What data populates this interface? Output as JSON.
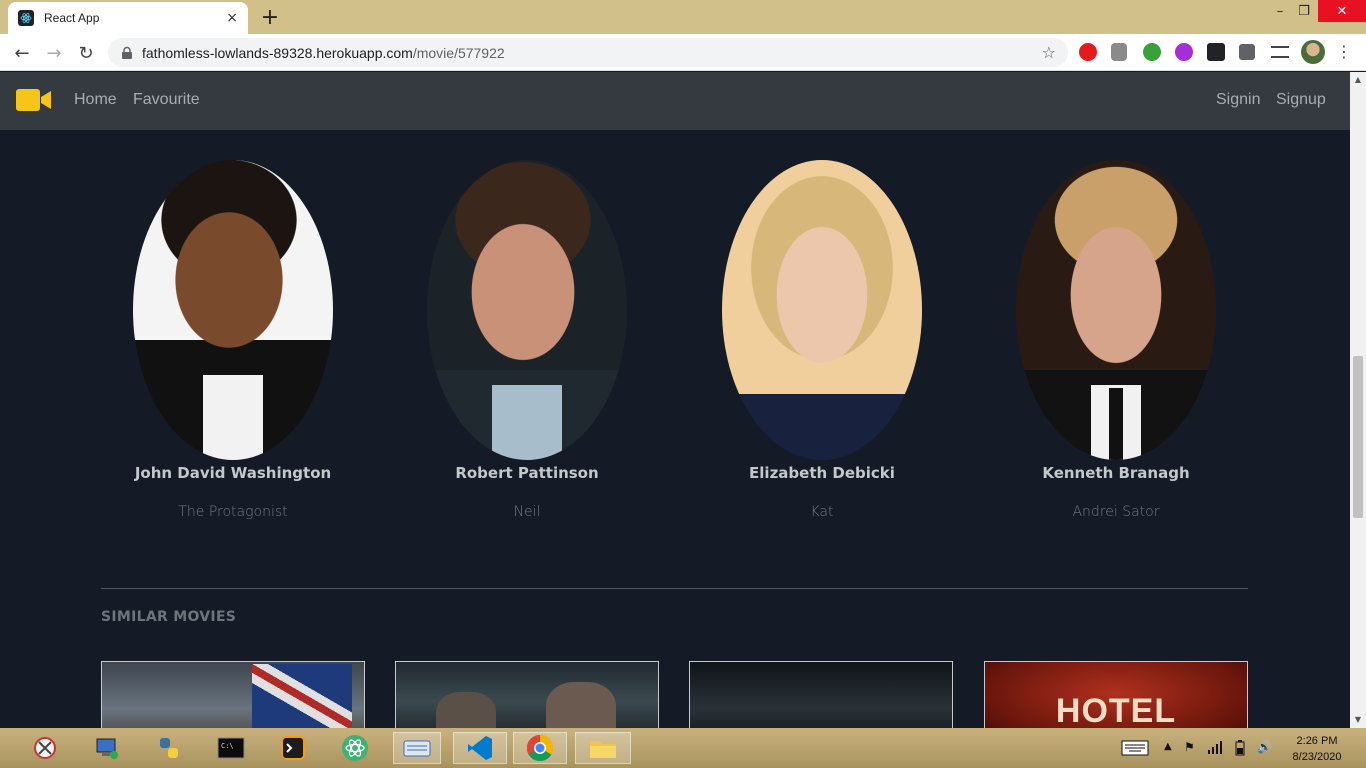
{
  "browser": {
    "tab_title": "React App",
    "url_host": "fathomless-lowlands-89328.herokuapp.com",
    "url_path": "/movie/577922",
    "tab_close": "×",
    "new_tab": "+",
    "window": {
      "minimize": "–",
      "maximize": "❐",
      "close": "✕"
    },
    "back": "←",
    "forward": "→",
    "reload": "↻",
    "star": "☆",
    "menu": "⋮"
  },
  "app_nav": {
    "links": [
      "Home",
      "Favourite"
    ],
    "auth": [
      "Signin",
      "Signup"
    ]
  },
  "cast": [
    {
      "name": "John David Washington",
      "role": "The Protagonist"
    },
    {
      "name": "Robert Pattinson",
      "role": "Neil"
    },
    {
      "name": "Elizabeth Debicki",
      "role": "Kat"
    },
    {
      "name": "Kenneth Branagh",
      "role": "Andrei Sator"
    }
  ],
  "similar": {
    "title": "SIMILAR MOVIES",
    "posters": [
      {
        "text": ""
      },
      {
        "text": ""
      },
      {
        "text": ""
      },
      {
        "text": "HOTEL MUMBAI"
      }
    ]
  },
  "taskbar": {
    "time": "2:26 PM",
    "date": "8/23/2020"
  },
  "colors": {
    "page_bg": "#151b26",
    "navbar_bg": "#343a40",
    "brand": "#f5c518",
    "tab_strip": "#d2c08a"
  }
}
